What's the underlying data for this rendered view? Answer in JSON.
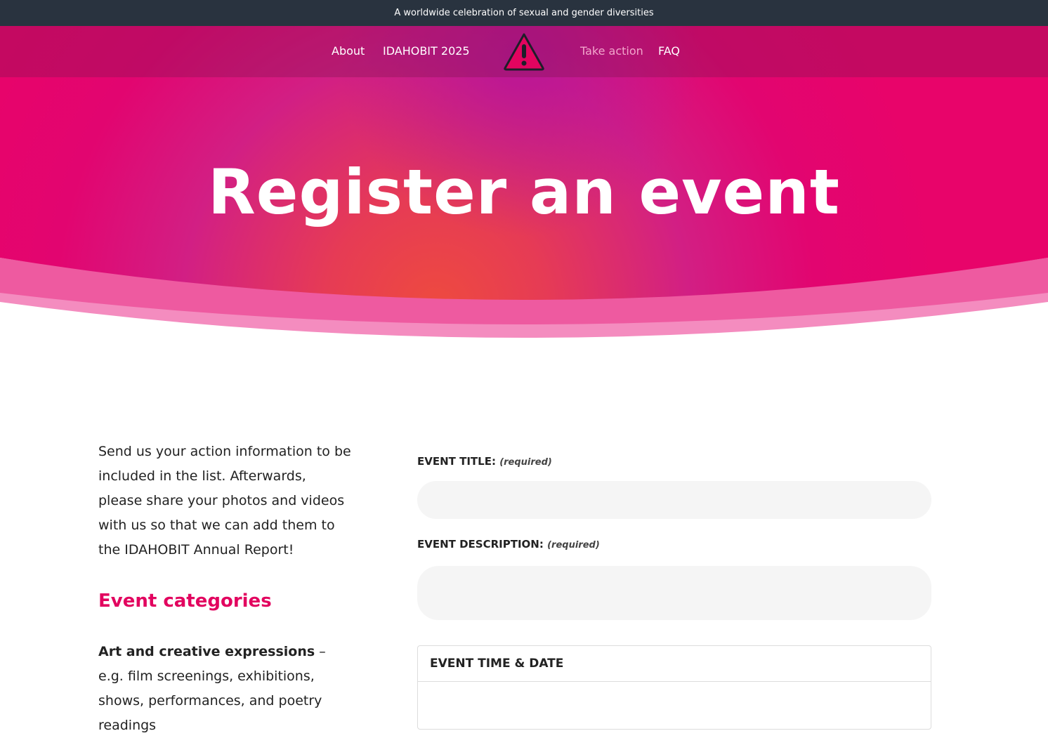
{
  "topbar": {
    "tagline": "A worldwide celebration of sexual and gender diversities"
  },
  "nav": {
    "items": [
      {
        "label": "About"
      },
      {
        "label": "IDAHOBIT 2025"
      },
      {
        "label": "Take action"
      },
      {
        "label": "FAQ"
      }
    ],
    "logo_icon": "warning-triangle-icon"
  },
  "hero": {
    "title": "Register an event"
  },
  "intro": {
    "text": "Send us your action information to be included in the list. Afterwards, please share your photos and videos with us so that we can add them to the IDAHOBIT Annual Report!"
  },
  "categories": {
    "heading": "Event categories",
    "first_bold": "Art and creative expressions",
    "first_rest": " – e.g. film screenings, exhibitions, shows, performances, and poetry readings"
  },
  "form": {
    "title_label": "EVENT TITLE:",
    "title_required": "(required)",
    "description_label": "EVENT DESCRIPTION:",
    "description_required": "(required)",
    "time_panel_heading": "EVENT TIME & DATE"
  },
  "colors": {
    "brand_pink": "#e2045f",
    "topbar_bg": "#29333f",
    "input_bg": "#f5f5f5"
  }
}
